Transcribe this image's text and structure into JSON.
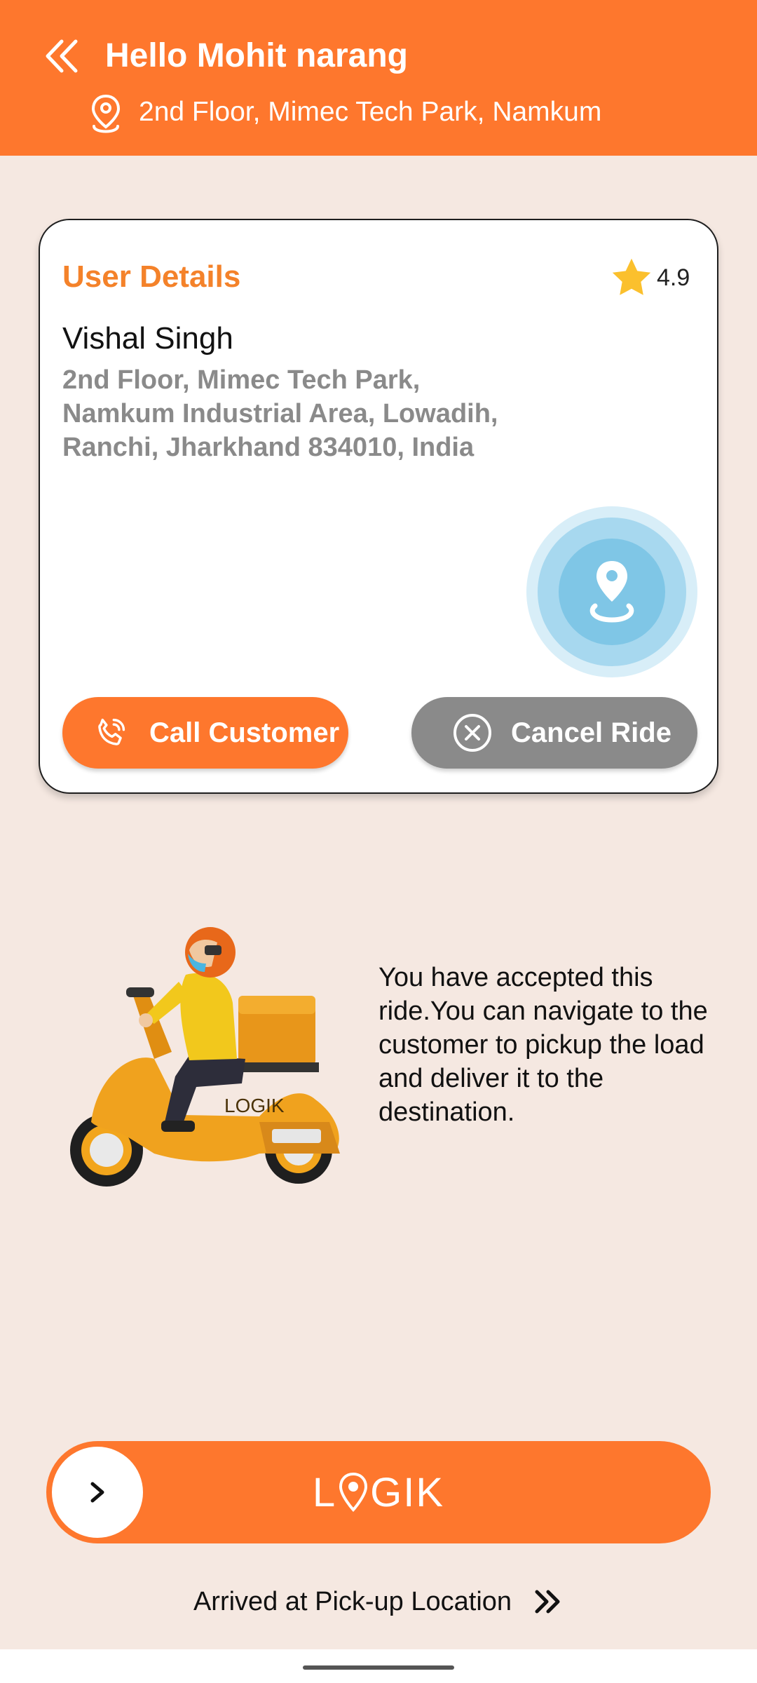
{
  "header": {
    "greeting": "Hello Mohit narang",
    "location": "2nd Floor, Mimec Tech Park, Namkum",
    "back_icon": "double-chevron-left-icon",
    "location_icon": "map-pin-icon"
  },
  "user_card": {
    "title": "User Details",
    "rating": "4.9",
    "customer_name": "Vishal Singh",
    "address_lines": [
      "2nd Floor, Mimec Tech Park,",
      "Namkum Industrial Area, Lowadih,",
      "Ranchi, Jharkhand 834010, India"
    ],
    "call_button": "Call Customer",
    "cancel_button": "Cancel Ride"
  },
  "info": {
    "message": "You have accepted this ride.You can navigate to the customer to pickup the load and deliver it to the destination."
  },
  "slider": {
    "brand_left": "L",
    "brand_right": "GIK",
    "logo_text": "LOGIK"
  },
  "footer": {
    "arrived_label": "Arrived at Pick-up Location"
  },
  "colors": {
    "primary": "#fe772d",
    "background": "#f5e8e1",
    "title_accent": "#f4822a",
    "cancel_gray": "#8a8a8a",
    "star": "#fbc02d",
    "pin_blue": "#7fc6e6"
  }
}
